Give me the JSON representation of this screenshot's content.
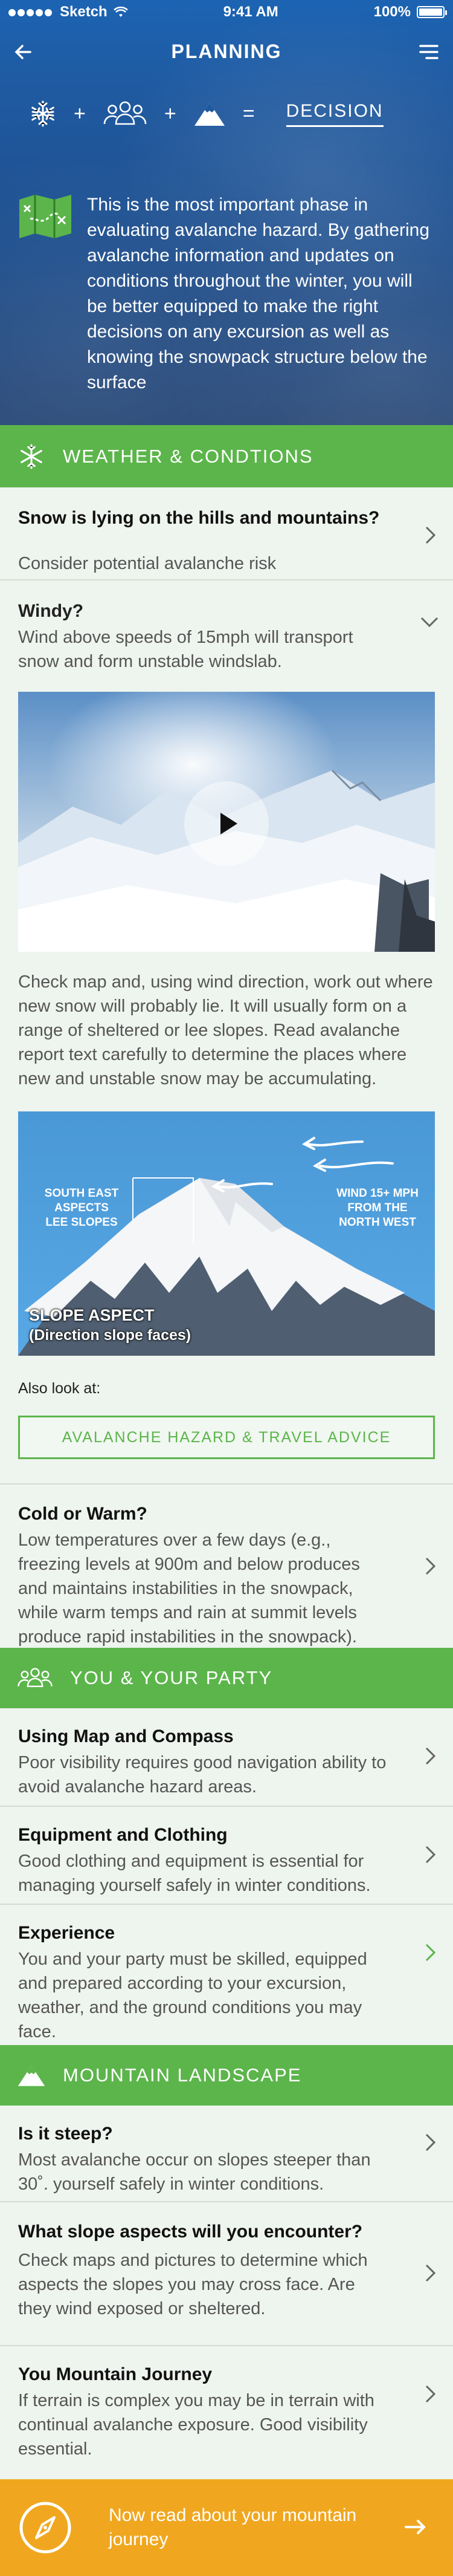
{
  "status_bar": {
    "carrier": "Sketch",
    "time": "9:41 AM",
    "battery": "100%"
  },
  "nav": {
    "title": "PLANNING"
  },
  "equation": {
    "plus": "+",
    "equals": "=",
    "decision": "DECISION"
  },
  "intro": {
    "text": "This is the most important phase in evaluating avalanche hazard. By gathering avalanche information and updates on conditions throughout the winter, you will be better equipped to make the right decisions on any excursion as well as knowing the snowpack structure below the surface"
  },
  "weather": {
    "header": "WEATHER & CONDTIONS",
    "snow": {
      "title": "Snow is lying on the hills and mountains?",
      "desc": "Consider potential avalanche risk"
    },
    "windy": {
      "title": "Windy?",
      "desc": "Wind above speeds of 15mph will transport snow and form unstable windslab."
    },
    "map_text": "Check map and, using wind direction, work out where new snow will probably lie. It will usually form on a range of sheltered or lee slopes. Read avalanche report text carefully to determine the places where new and unstable snow may be accumulating.",
    "diagram": {
      "lee": "SOUTH EAST\nASPECTS\nLEE SLOPES",
      "wind": "WIND 15+ MPH\nFROM THE\nNORTH WEST",
      "aspect_title": "SLOPE ASPECT",
      "aspect_sub": "(Direction slope faces)"
    },
    "also_look": "Also look at:",
    "advice_button": "AVALANCHE HAZARD & TRAVEL ADVICE",
    "cold": {
      "title": "Cold or Warm?",
      "desc": "Low temperatures over a few days (e.g., freezing levels at 900m and below produces and maintains instabilities in the snowpack, while warm temps and rain at summit levels produce rapid instabilities in the snowpack)."
    }
  },
  "party": {
    "header": "YOU & YOUR PARTY",
    "items": [
      {
        "title": "Using Map and Compass",
        "desc": "Poor visibility requires good navigation ability to avoid avalanche hazard areas."
      },
      {
        "title": "Equipment and Clothing",
        "desc": "Good clothing and equipment is essential for managing yourself safely in winter conditions."
      },
      {
        "title": "Experience",
        "desc": "You and your party must be skilled, equipped and prepared according to your excursion, weather, and the ground conditions you may face."
      }
    ]
  },
  "landscape": {
    "header": "MOUNTAIN LANDSCAPE",
    "items": [
      {
        "title": "Is it steep?",
        "desc": "Most avalanche occur on slopes steeper than 30˚. yourself safely in winter conditions."
      },
      {
        "title": "What slope aspects will you encounter?",
        "desc": "Check maps and pictures to determine which aspects the slopes you may cross face. Are they wind exposed or sheltered."
      },
      {
        "title": "You Mountain Journey",
        "desc": "If terrain is complex you may be in terrain with continual avalanche exposure. Good visibility essential."
      }
    ]
  },
  "footer": {
    "text": "Now read about your mountain journey"
  },
  "colors": {
    "green": "#5cb54b",
    "blue": "#1f5aa1",
    "orange": "#f0a71f"
  }
}
